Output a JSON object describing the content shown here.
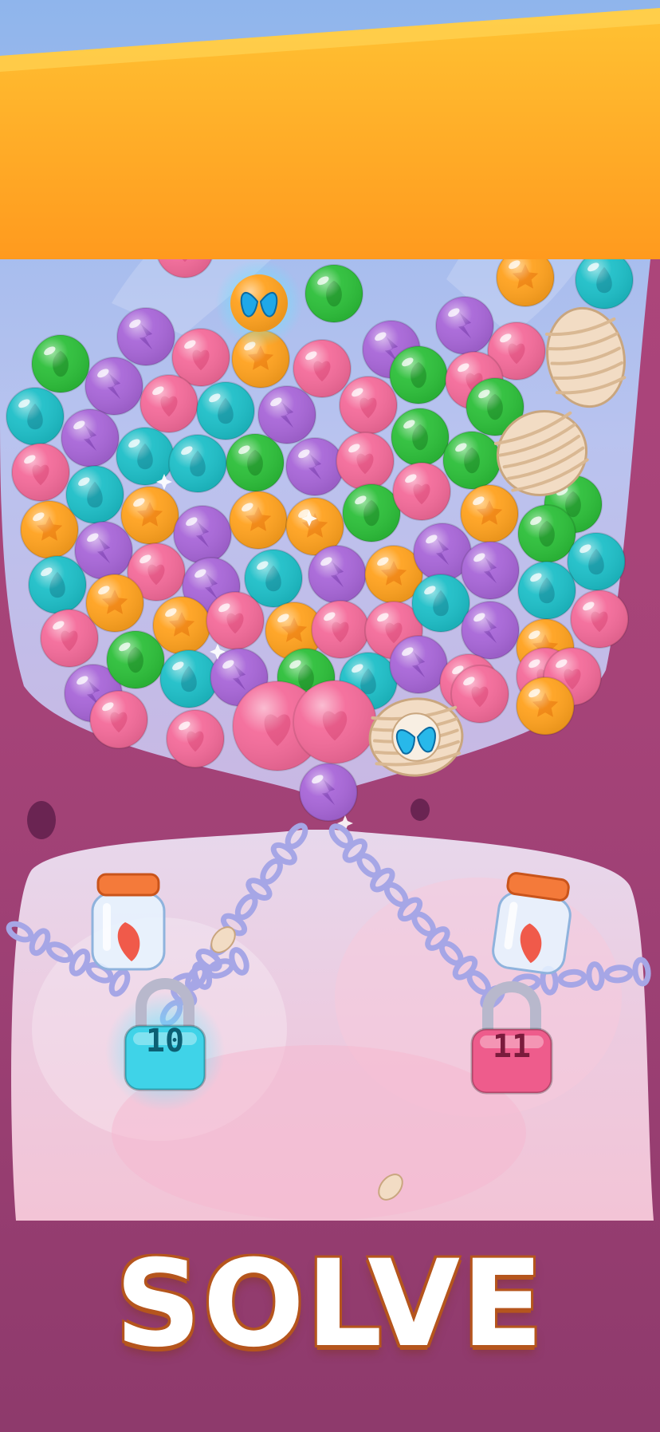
{
  "game": {
    "banner_text": "SOLVE",
    "locks": [
      {
        "id": "left",
        "number": "10",
        "color": "#3fd3e8"
      },
      {
        "id": "right",
        "number": "11",
        "color": "#ee5c8c"
      }
    ],
    "jars": [
      {
        "id": "left",
        "content": "red-feather-icon"
      },
      {
        "id": "right",
        "content": "red-feather-icon"
      }
    ],
    "special_items": [
      "butterfly-bubble",
      "cocoon",
      "cocoon",
      "cocoon-with-butterfly"
    ],
    "bubble_colors": {
      "pink": "#f46b9a",
      "purple": "#a866d8",
      "green": "#2dbf3a",
      "teal": "#1ebfc8",
      "orange": "#ffa21f"
    }
  }
}
